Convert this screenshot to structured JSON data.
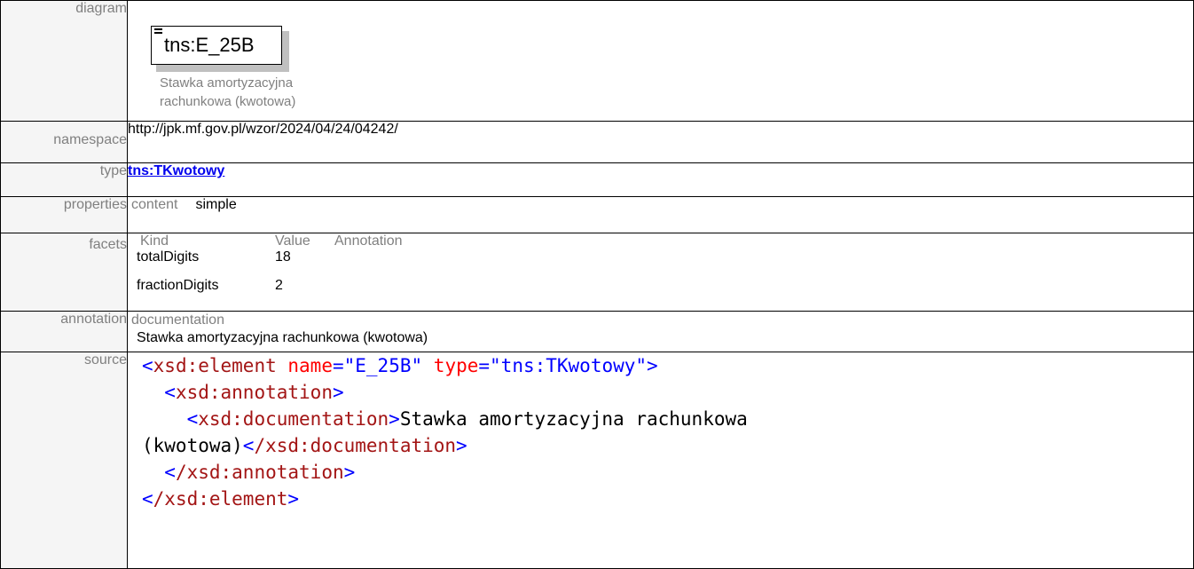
{
  "labels": {
    "diagram": "diagram",
    "namespace": "namespace",
    "type": "type",
    "properties": "properties",
    "facets": "facets",
    "annotation": "annotation",
    "source": "source"
  },
  "diagram": {
    "element_name": "tns:E_25B",
    "description_line1": "Stawka amortyzacyjna",
    "description_line2": "rachunkowa (kwotowa)"
  },
  "namespace": "http://jpk.mf.gov.pl/wzor/2024/04/24/04242/",
  "type": "tns:TKwotowy",
  "properties": {
    "key": "content",
    "value": "simple"
  },
  "facets": {
    "headers": [
      "Kind",
      "Value",
      "Annotation"
    ],
    "rows": [
      {
        "kind": "totalDigits",
        "value": "18"
      },
      {
        "kind": "fractionDigits",
        "value": "2"
      }
    ]
  },
  "annotation": {
    "key": "documentation",
    "value": "Stawka amortyzacyjna rachunkowa (kwotowa)"
  },
  "source": {
    "l1_open": "<",
    "l1_tag": "xsd:element",
    "l1_attr1": "name",
    "l1_eq1": "=",
    "l1_val1": "\"E_25B\"",
    "l1_attr2": "type",
    "l1_eq2": "=",
    "l1_val2": "\"tns:TKwotowy\"",
    "l1_close": ">",
    "l2_tag": "xsd:annotation",
    "l3_tag": "xsd:documentation",
    "l3_text": "Stawka amortyzacyjna rachunkowa",
    "l4_text": "(kwotowa)",
    "l4_tag": "/xsd:documentation",
    "l5_tag": "/xsd:annotation",
    "l6_tag": "/xsd:element"
  }
}
